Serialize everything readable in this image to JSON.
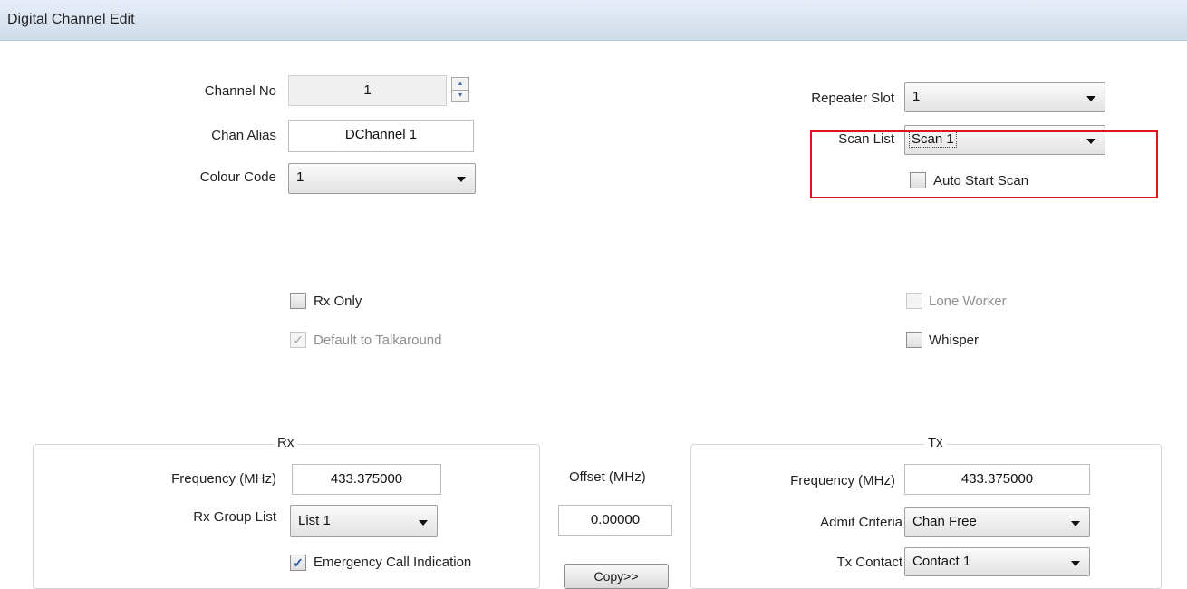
{
  "window": {
    "title": "Digital Channel Edit"
  },
  "general": {
    "channel_no": {
      "label": "Channel No",
      "value": "1"
    },
    "chan_alias": {
      "label": "Chan Alias",
      "value": "DChannel 1"
    },
    "colour_code": {
      "label": "Colour Code",
      "value": "1"
    },
    "repeater_slot": {
      "label": "Repeater Slot",
      "value": "1"
    },
    "scan_list": {
      "label": "Scan List",
      "value": "Scan 1"
    },
    "auto_start_scan": {
      "label": "Auto Start Scan",
      "checked": false
    }
  },
  "options": {
    "rx_only": {
      "label": "Rx Only",
      "checked": false
    },
    "default_to_talkaround": {
      "label": "Default to Talkaround",
      "checked": true,
      "enabled": false
    },
    "lone_worker": {
      "label": "Lone Worker",
      "checked": false,
      "enabled": false
    },
    "whisper": {
      "label": "Whisper",
      "checked": false
    }
  },
  "rx": {
    "title": "Rx",
    "frequency": {
      "label": "Frequency (MHz)",
      "value": "433.375000"
    },
    "group_list": {
      "label": "Rx Group List",
      "value": "List 1"
    },
    "emergency_call_indication": {
      "label": "Emergency Call Indication",
      "checked": true
    }
  },
  "offset": {
    "label": "Offset (MHz)",
    "value": "0.00000",
    "copy_button": "Copy>>"
  },
  "tx": {
    "title": "Tx",
    "frequency": {
      "label": "Frequency (MHz)",
      "value": "433.375000"
    },
    "admit_criteria": {
      "label": "Admit Criteria",
      "value": "Chan Free"
    },
    "tx_contact": {
      "label": "Tx Contact",
      "value": "Contact 1"
    }
  },
  "colors": {
    "highlight": "#e0141c",
    "check_accent": "#2456a6",
    "titlebar": "#d6e2f0"
  }
}
